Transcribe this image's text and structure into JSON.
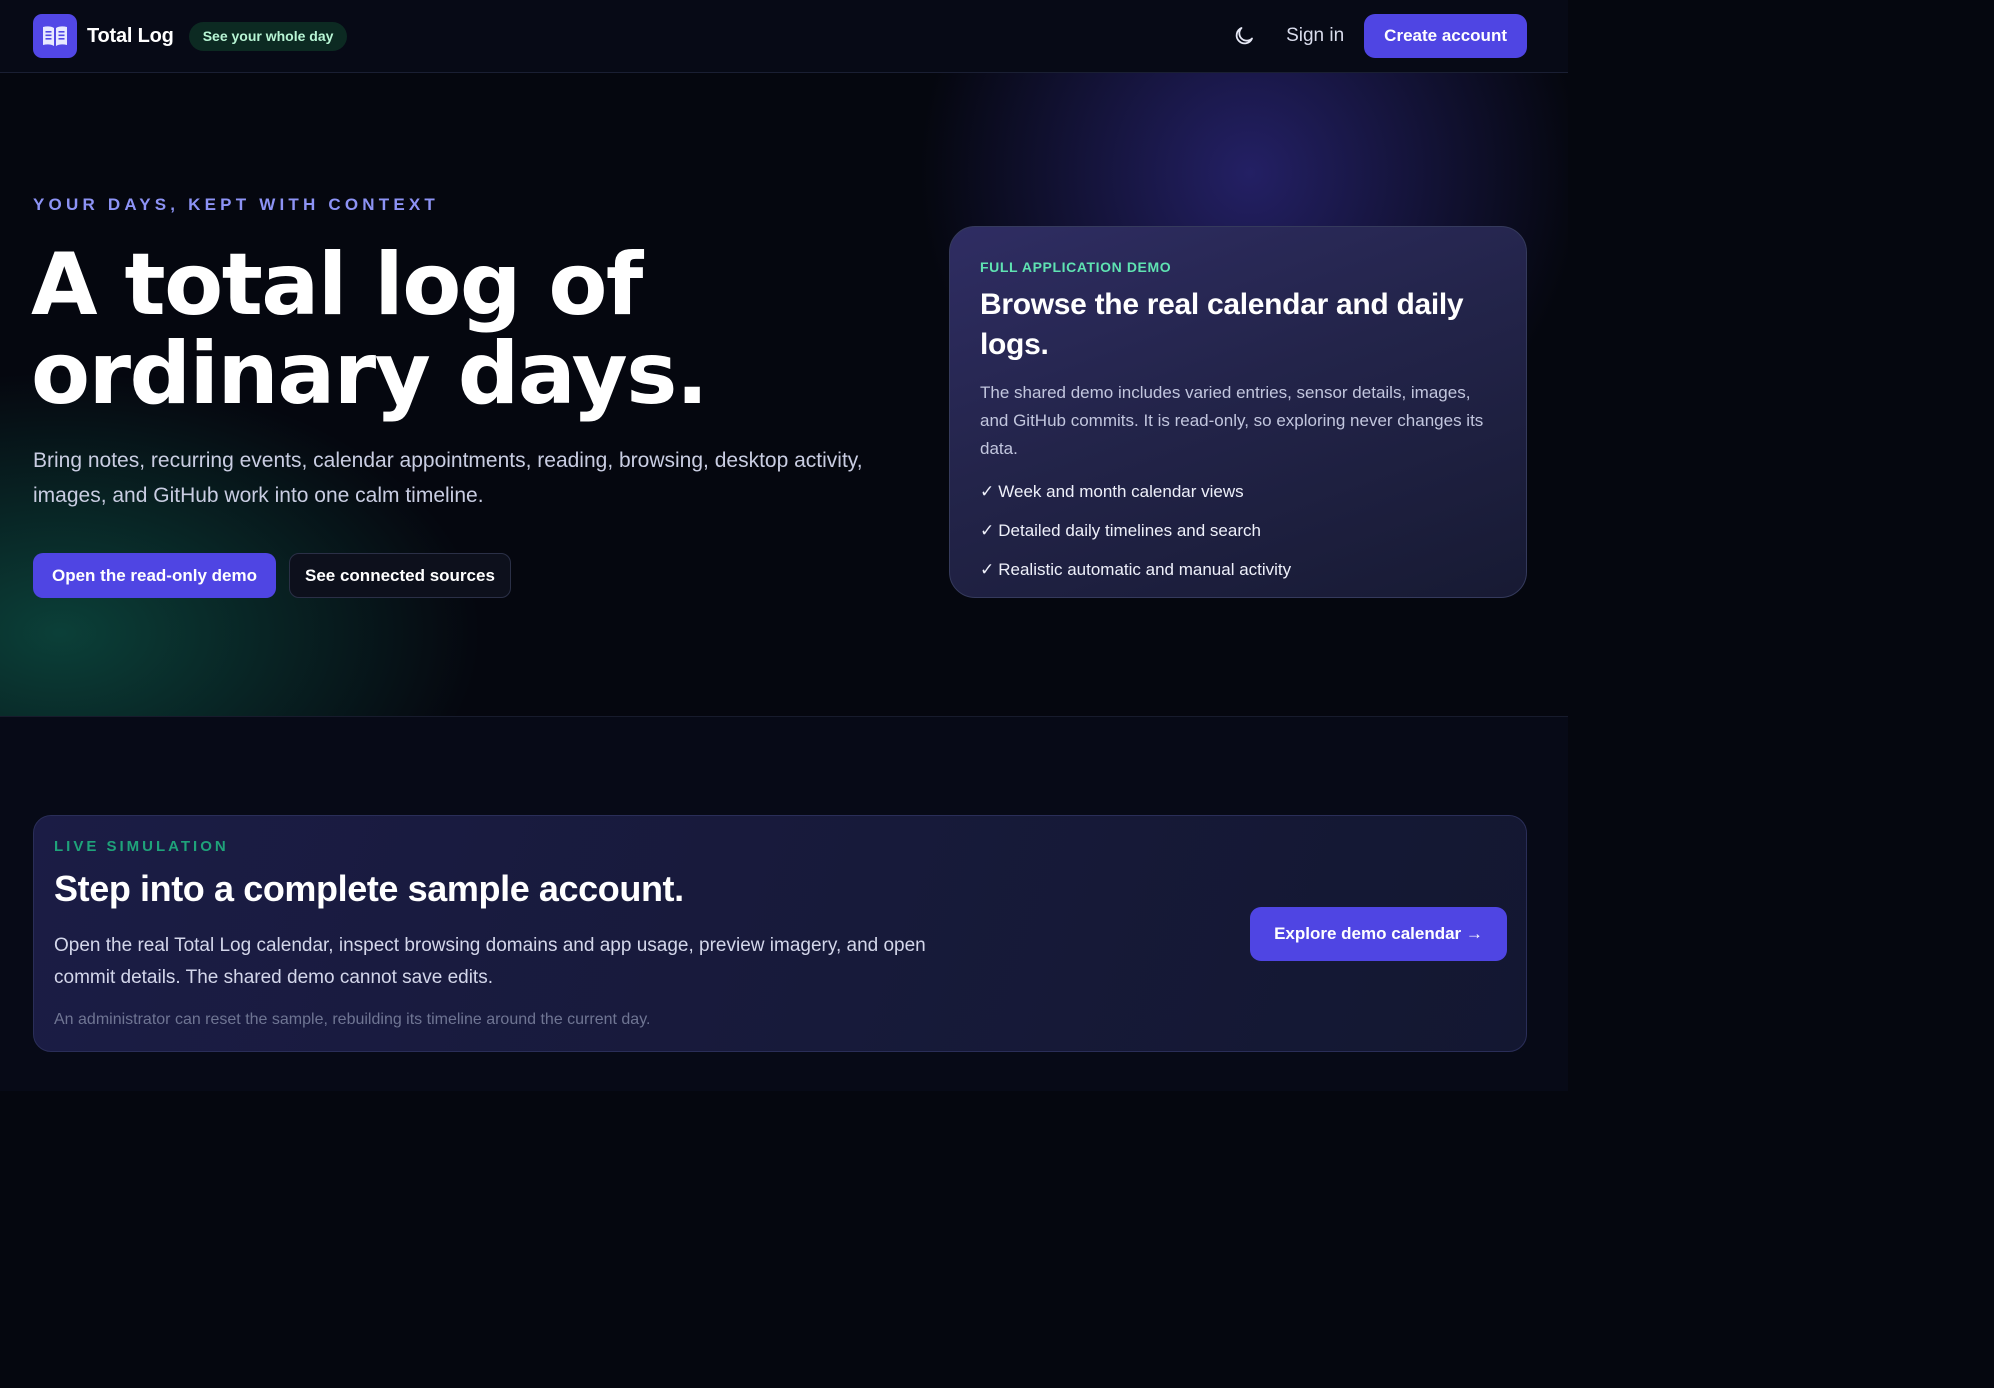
{
  "header": {
    "brand": "Total Log",
    "tagline": "See your whole day",
    "theme_icon": "moon-icon",
    "sign_in": "Sign in",
    "create_account": "Create account"
  },
  "hero": {
    "eyebrow": "YOUR DAYS, KEPT WITH CONTEXT",
    "title": "A total log of ordinary days.",
    "description": "Bring notes, recurring events, calendar appointments, reading, browsing, desktop activity, images, and GitHub work into one calm timeline.",
    "primary_button": "Open the read-only demo",
    "secondary_button": "See connected sources"
  },
  "demo_card": {
    "eyebrow": "FULL APPLICATION DEMO",
    "title": "Browse the real calendar and daily logs.",
    "description": "The shared demo includes varied entries, sensor details, images, and GitHub commits. It is read-only, so exploring never changes its data.",
    "check_glyph": "✓",
    "features": [
      "Week and month calendar views",
      "Detailed daily timelines and search",
      "Realistic automatic and manual activity"
    ]
  },
  "simulation": {
    "eyebrow": "LIVE SIMULATION",
    "title": "Step into a complete sample account.",
    "description": "Open the real Total Log calendar, inspect browsing domains and app usage, preview imagery, and open commit details. The shared demo cannot save edits.",
    "note": "An administrator can reset the sample, rebuilding its timeline around the current day.",
    "button": "Explore demo calendar →"
  },
  "colors": {
    "accent": "#4f45e3",
    "background": "#05070f",
    "eyebrow_purple": "#8d93f5",
    "eyebrow_green": "#5fe3b2",
    "sim_eyebrow_green": "#1fa37a",
    "pill_bg": "#0c2a22",
    "pill_text": "#b7f5d4"
  }
}
